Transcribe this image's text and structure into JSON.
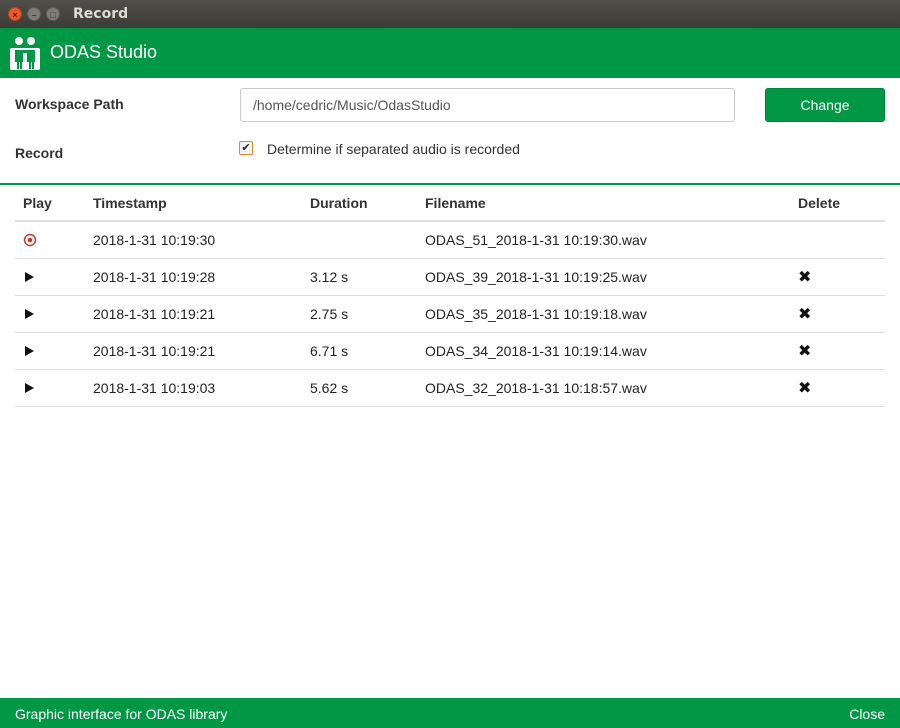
{
  "window": {
    "title": "Record",
    "close_glyph": "×",
    "minimize_glyph": "–",
    "maximize_glyph": "□"
  },
  "app": {
    "title": "ODAS Studio",
    "logo_icon": "people-logo-icon",
    "accent_color": "#009845"
  },
  "settings": {
    "workspace_label": "Workspace Path",
    "workspace_path": "/home/cedric/Music/OdasStudio",
    "change_label": "Change",
    "record_label": "Record",
    "record_checkbox_label": "Determine if separated audio is recorded",
    "record_checked": true
  },
  "table": {
    "headers": {
      "play": "Play",
      "timestamp": "Timestamp",
      "duration": "Duration",
      "filename": "Filename",
      "delete": "Delete"
    },
    "rows": [
      {
        "state": "recording",
        "timestamp": "2018-1-31 10:19:30",
        "duration": "",
        "filename": "ODAS_51_2018-1-31 10:19:30.wav",
        "deletable": false
      },
      {
        "state": "stopped",
        "timestamp": "2018-1-31 10:19:28",
        "duration": "3.12 s",
        "filename": "ODAS_39_2018-1-31 10:19:25.wav",
        "deletable": true
      },
      {
        "state": "stopped",
        "timestamp": "2018-1-31 10:19:21",
        "duration": "2.75 s",
        "filename": "ODAS_35_2018-1-31 10:19:18.wav",
        "deletable": true
      },
      {
        "state": "stopped",
        "timestamp": "2018-1-31 10:19:21",
        "duration": "6.71 s",
        "filename": "ODAS_34_2018-1-31 10:19:14.wav",
        "deletable": true
      },
      {
        "state": "stopped",
        "timestamp": "2018-1-31 10:19:03",
        "duration": "5.62 s",
        "filename": "ODAS_32_2018-1-31 10:18:57.wav",
        "deletable": true
      }
    ],
    "delete_glyph": "✖"
  },
  "footer": {
    "text": "Graphic interface for ODAS library",
    "close_label": "Close"
  }
}
